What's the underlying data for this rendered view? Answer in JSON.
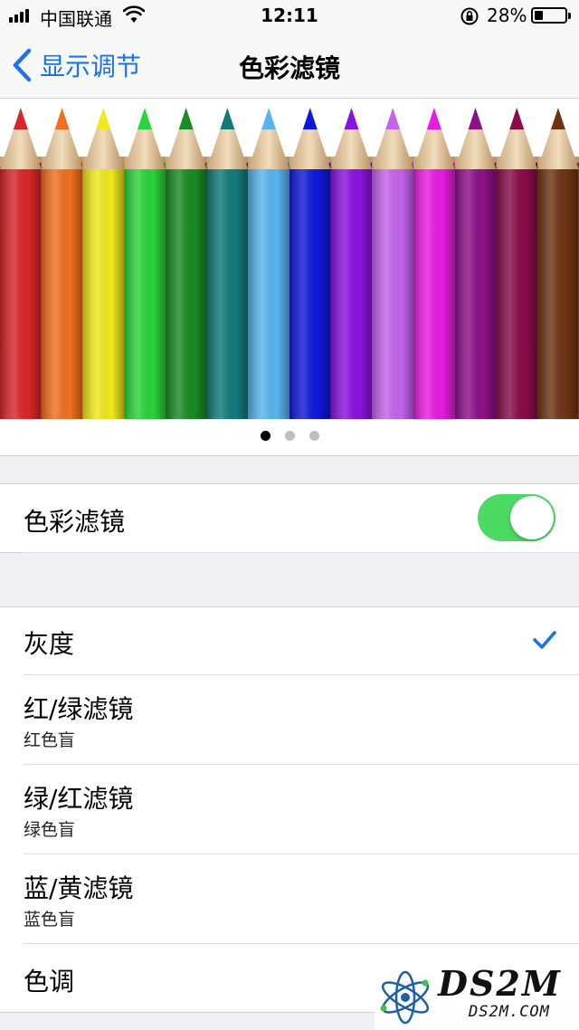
{
  "status_bar": {
    "carrier": "中国联通",
    "time": "12:11",
    "battery_percent": "28%",
    "battery_level": 0.28,
    "icons": [
      "signal-icon",
      "wifi-icon",
      "orientation-lock-icon",
      "battery-icon"
    ]
  },
  "nav": {
    "back_label": "显示调节",
    "title": "色彩滤镜"
  },
  "preview": {
    "page_count": 3,
    "active_page": 1,
    "pencil_colors": [
      "#d8262a",
      "#f07020",
      "#f0e81c",
      "#2ad43a",
      "#1a8a24",
      "#137a7a",
      "#58b4ee",
      "#1018d8",
      "#8a12e0",
      "#c464ec",
      "#e81ce0",
      "#8c1088",
      "#8a0c4a",
      "#6e3412"
    ]
  },
  "main_toggle": {
    "label": "色彩滤镜",
    "on": true,
    "on_color": "#4cd964"
  },
  "filters": [
    {
      "label": "灰度",
      "sub": "",
      "selected": true
    },
    {
      "label": "红/绿滤镜",
      "sub": "红色盲",
      "selected": false
    },
    {
      "label": "绿/红滤镜",
      "sub": "绿色盲",
      "selected": false
    },
    {
      "label": "蓝/黄滤镜",
      "sub": "蓝色盲",
      "selected": false
    },
    {
      "label": "色调",
      "sub": "",
      "selected": false
    }
  ],
  "watermark": {
    "main": "DS2M",
    "url": "DS2M.COM"
  },
  "colors": {
    "accent": "#1a73e8",
    "background": "#efeff4"
  }
}
